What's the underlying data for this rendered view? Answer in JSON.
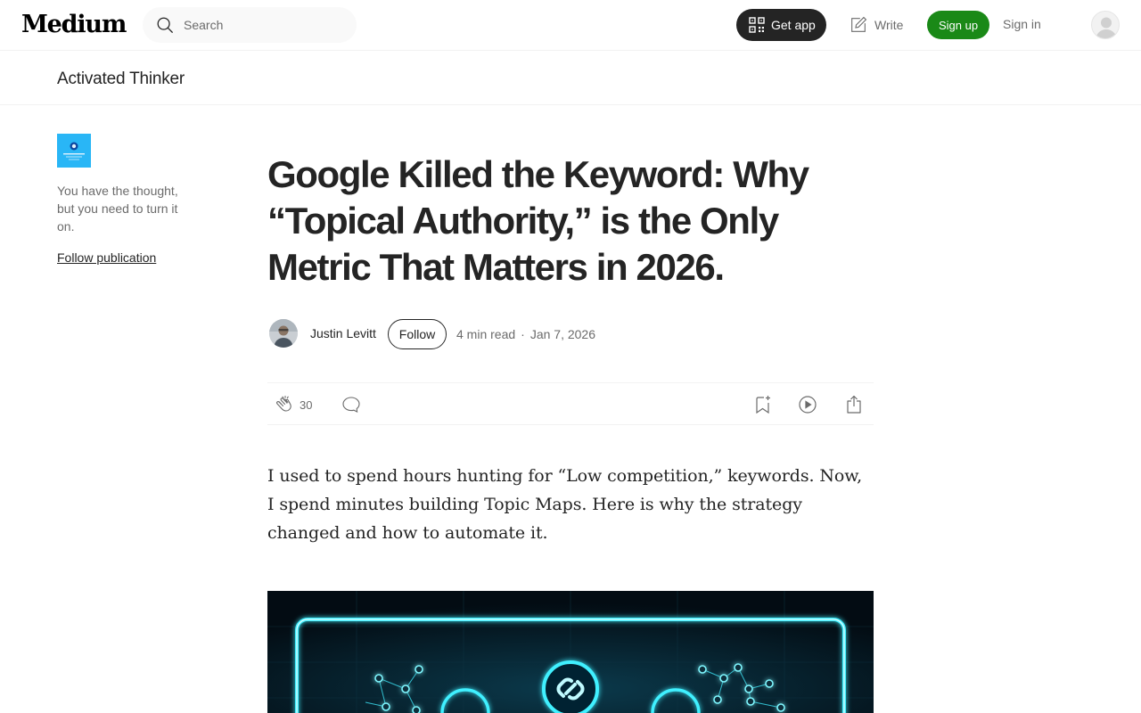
{
  "header": {
    "logo": "Medium",
    "search_placeholder": "Search",
    "get_app": "Get app",
    "write": "Write",
    "sign_up": "Sign up",
    "sign_in": "Sign in"
  },
  "publication": {
    "name": "Activated Thinker",
    "description": "You have the thought, but you need to turn it on.",
    "follow_label": "Follow publication"
  },
  "article": {
    "title": "Google Killed the Keyword: Why “Topical Authority,” is the Only Metric That Matters in 2026.",
    "author": "Justin Levitt",
    "follow_label": "Follow",
    "read_time": "4 min read",
    "date": "Jan 7, 2026",
    "claps": "30",
    "subtitle": "I used to spend hours hunting for “Low competition,” keywords. Now, I spend minutes building Topic Maps. Here is why the strategy changed and how to automate it."
  },
  "colors": {
    "accent_green": "#1a8917",
    "text_primary": "#242424",
    "text_secondary": "#6b6b6b",
    "neon": "#3ff0ff"
  },
  "icons": [
    "search-icon",
    "qr-icon",
    "write-icon",
    "user-icon",
    "clap-icon",
    "comment-icon",
    "bookmark-icon",
    "play-icon",
    "share-icon",
    "link-icon"
  ]
}
